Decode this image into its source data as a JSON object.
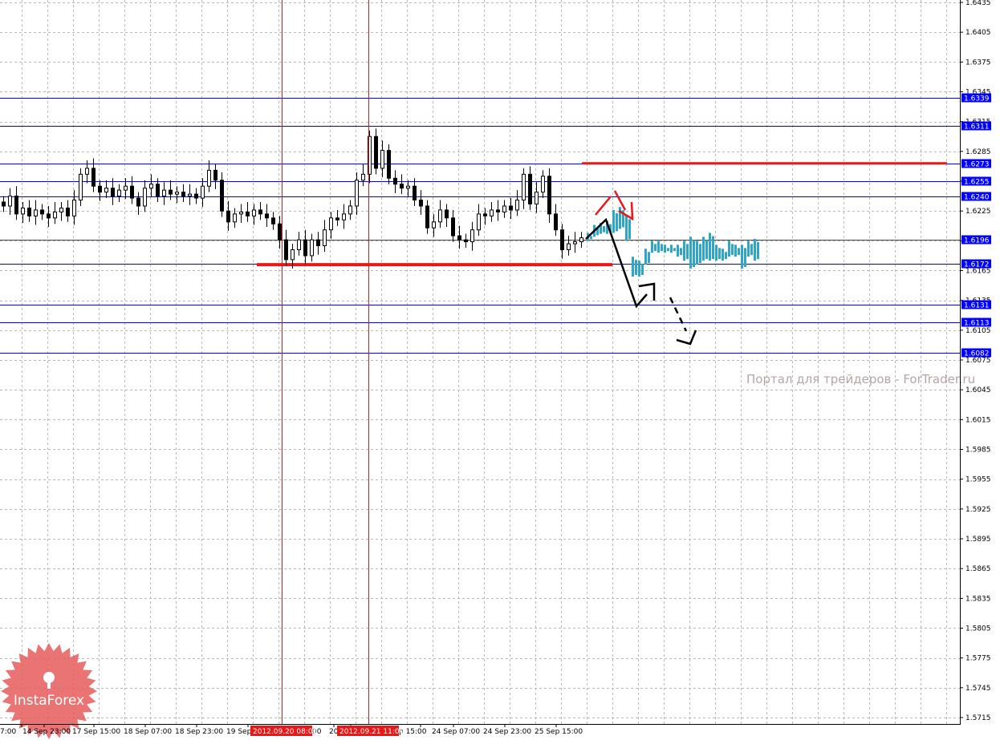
{
  "chart_data": {
    "type": "candlestick",
    "title": "",
    "watermark": "Портал для трейдеров - ForTrader.ru",
    "logo": "InstaForex",
    "ylim": [
      1.5715,
      1.6435
    ],
    "y_ticks": [
      1.6435,
      1.6405,
      1.6375,
      1.6345,
      1.6315,
      1.6285,
      1.6255,
      1.6225,
      1.6195,
      1.6165,
      1.6135,
      1.6105,
      1.6075,
      1.6045,
      1.6015,
      1.5985,
      1.5955,
      1.5925,
      1.5895,
      1.5865,
      1.5835,
      1.5805,
      1.5775,
      1.5745,
      1.5715
    ],
    "y_tick_labels": [
      "1.6435",
      "1.6405",
      "1.6375",
      "1.6345",
      "1.6315",
      "1.6285",
      "1.6255",
      "1.6225",
      "1.6195",
      "1.6165",
      "1.6135",
      "1.6105",
      "1.6075",
      "1.6045",
      "1.6015",
      "1.5985",
      "1.5955",
      "1.5925",
      "1.5895",
      "1.5865",
      "1.5835",
      "1.5805",
      "1.5775",
      "1.5745",
      "1.5715"
    ],
    "x_tick_labels": [
      "7:00",
      "14 Sep 23:00",
      "17 Sep 15:00",
      "18 Sep 07:00",
      "18 Sep 23:00",
      "19 Sep",
      "00",
      "20",
      "p 15:00",
      "24 Sep 07:00",
      "24 Sep 23:00",
      "25 Sep 15:00"
    ],
    "highlighted_times": [
      "2012.09.20 08:00",
      "2012.09.21 11:00"
    ],
    "levels": [
      {
        "value": 1.6339,
        "label": "1.6339"
      },
      {
        "value": 1.6311,
        "label": "1.6311"
      },
      {
        "value": 1.6273,
        "label": "1.6273"
      },
      {
        "value": 1.6255,
        "label": "1.6255"
      },
      {
        "value": 1.624,
        "label": "1.6240"
      },
      {
        "value": 1.6196,
        "label": "1.6196"
      },
      {
        "value": 1.6172,
        "label": "1.6172"
      },
      {
        "value": 1.6131,
        "label": "1.6131"
      },
      {
        "value": 1.6113,
        "label": "1.6113"
      },
      {
        "value": 1.6082,
        "label": "1.6082"
      }
    ],
    "support_resistance": [
      {
        "value": 1.6273,
        "color": "#e81818"
      },
      {
        "value": 1.6171,
        "color": "#e81818"
      }
    ],
    "closes": [
      1.623,
      1.624,
      1.6222,
      1.6228,
      1.622,
      1.6226,
      1.6222,
      1.6218,
      1.6224,
      1.6228,
      1.622,
      1.6236,
      1.6262,
      1.6268,
      1.625,
      1.6244,
      1.6248,
      1.624,
      1.6246,
      1.625,
      1.6238,
      1.623,
      1.6248,
      1.6252,
      1.624,
      1.6246,
      1.6242,
      1.6244,
      1.624,
      1.6242,
      1.6238,
      1.625,
      1.6266,
      1.6256,
      1.6225,
      1.6214,
      1.6222,
      1.6224,
      1.622,
      1.6226,
      1.6222,
      1.6218,
      1.6212,
      1.6196,
      1.6176,
      1.6186,
      1.6196,
      1.618,
      1.6196,
      1.619,
      1.6206,
      1.6218,
      1.6216,
      1.6222,
      1.623,
      1.6256,
      1.6262,
      1.63,
      1.6268,
      1.6286,
      1.6258,
      1.6252,
      1.6248,
      1.625,
      1.6236,
      1.623,
      1.6208,
      1.6214,
      1.6226,
      1.6218,
      1.62,
      1.6196,
      1.6194,
      1.6206,
      1.6222,
      1.622,
      1.6226,
      1.6224,
      1.623,
      1.6226,
      1.6236,
      1.6262,
      1.6232,
      1.6244,
      1.626,
      1.6222,
      1.6206,
      1.6186,
      1.6192,
      1.6194,
      1.6198
    ],
    "forecast_bars": [
      [
        1.6195,
        1.6203
      ],
      [
        1.6199,
        1.6211
      ],
      [
        1.6202,
        1.6213
      ],
      [
        1.6202,
        1.6215
      ],
      [
        1.6203,
        1.6226
      ],
      [
        1.6207,
        1.6229
      ],
      [
        1.6195,
        1.622
      ],
      [
        1.6159,
        1.6179
      ],
      [
        1.6159,
        1.6175
      ],
      [
        1.6171,
        1.6187
      ],
      [
        1.6183,
        1.6195
      ],
      [
        1.6183,
        1.6195
      ],
      [
        1.6183,
        1.6191
      ],
      [
        1.6183,
        1.6191
      ],
      [
        1.6179,
        1.6191
      ],
      [
        1.6175,
        1.6195
      ],
      [
        1.6167,
        1.6199
      ],
      [
        1.6171,
        1.6195
      ],
      [
        1.6175,
        1.6199
      ],
      [
        1.6175,
        1.6203
      ],
      [
        1.6175,
        1.6191
      ],
      [
        1.6175,
        1.6187
      ],
      [
        1.6179,
        1.6195
      ],
      [
        1.6179,
        1.6191
      ],
      [
        1.6167,
        1.6191
      ],
      [
        1.6179,
        1.6195
      ],
      [
        1.6175,
        1.6197
      ]
    ],
    "colors": {
      "level": "#0000ff",
      "label_bg": "#0000ff",
      "resistance": "#e81818",
      "forecast": "#2aa6cf",
      "vline": "#e01818",
      "grid": "#b8b8b8",
      "logo": "#e65a5a"
    }
  }
}
